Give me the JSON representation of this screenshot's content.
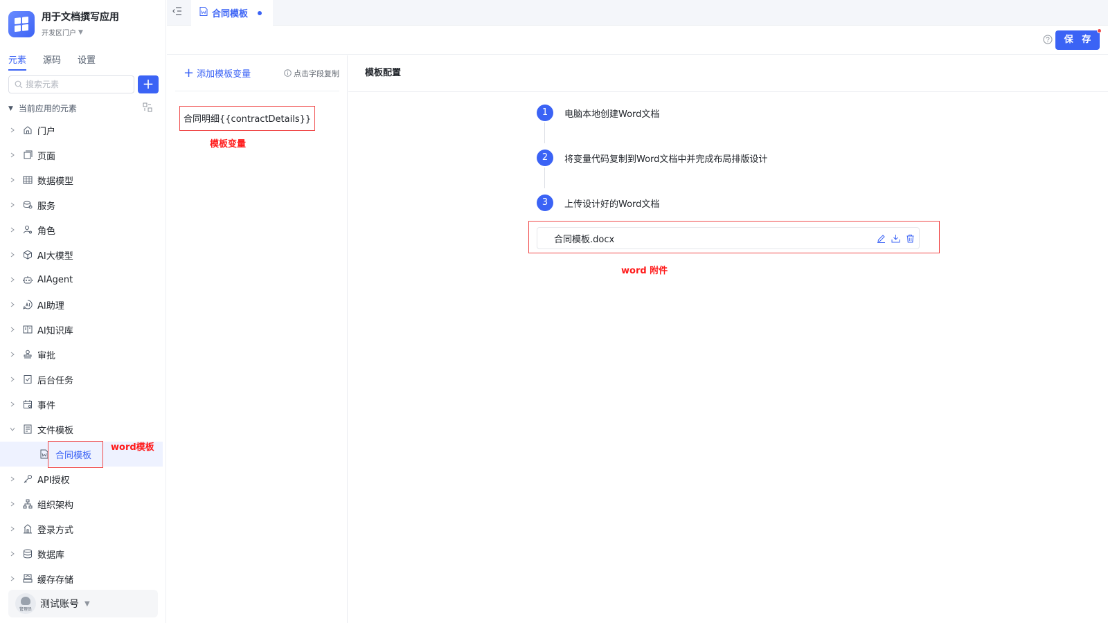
{
  "app": {
    "title": "用于文档撰写应用",
    "portal": "开发区门户"
  },
  "sidebar": {
    "tabs": [
      {
        "label": "元素",
        "active": true
      },
      {
        "label": "源码",
        "active": false
      },
      {
        "label": "设置",
        "active": false
      }
    ],
    "search_placeholder": "搜索元素",
    "tree_header": "当前应用的元素",
    "items": [
      {
        "label": "门户",
        "icon": "home-icon"
      },
      {
        "label": "页面",
        "icon": "page-icon"
      },
      {
        "label": "数据模型",
        "icon": "table-icon"
      },
      {
        "label": "服务",
        "icon": "service-icon"
      },
      {
        "label": "角色",
        "icon": "role-icon"
      },
      {
        "label": "AI大模型",
        "icon": "cube-icon"
      },
      {
        "label": "AIAgent",
        "icon": "robot-icon"
      },
      {
        "label": "AI助理",
        "icon": "ai-assistant-icon"
      },
      {
        "label": "AI知识库",
        "icon": "book-icon"
      },
      {
        "label": "审批",
        "icon": "stamp-icon"
      },
      {
        "label": "后台任务",
        "icon": "task-icon"
      },
      {
        "label": "事件",
        "icon": "event-icon"
      },
      {
        "label": "文件模板",
        "icon": "file-template-icon",
        "expanded": true
      },
      {
        "label": "API授权",
        "icon": "api-key-icon"
      },
      {
        "label": "组织架构",
        "icon": "org-icon"
      },
      {
        "label": "登录方式",
        "icon": "login-icon"
      },
      {
        "label": "数据库",
        "icon": "database-icon"
      },
      {
        "label": "缓存存储",
        "icon": "cache-icon"
      }
    ],
    "child_item": {
      "label": "合同模板",
      "icon": "word-file-icon"
    }
  },
  "user": {
    "name": "测试账号",
    "role": "管理员"
  },
  "tabbar": {
    "active_tab": "合同模板"
  },
  "toolbar": {
    "save_label": "保 存"
  },
  "variables": {
    "add_label": "添加模板变量",
    "copy_hint": "点击字段复制",
    "items": [
      "合同明细{{contractDetails}}"
    ]
  },
  "config": {
    "title": "模板配置",
    "steps": [
      {
        "num": "1",
        "text": "电脑本地创建Word文档"
      },
      {
        "num": "2",
        "text": "将变量代码复制到Word文档中并完成布局排版设计"
      },
      {
        "num": "3",
        "text": "上传设计好的Word文档"
      }
    ],
    "file_name": "合同模板.docx"
  },
  "annotations": {
    "word_template": "word模板",
    "template_variable": "模板变量",
    "word_attachment": "word 附件"
  },
  "colors": {
    "accent": "#3b63f5",
    "annotation": "#ff1a1a"
  }
}
